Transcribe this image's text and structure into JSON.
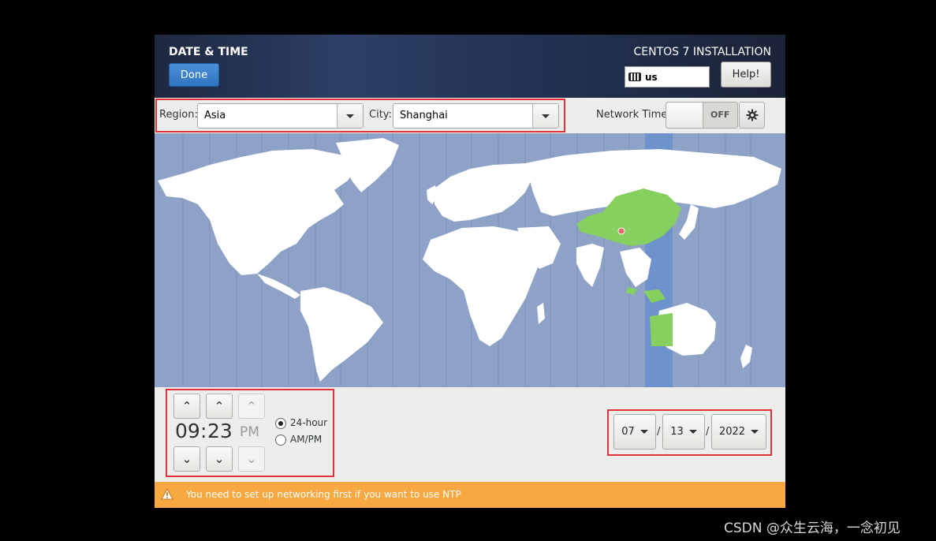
{
  "header": {
    "title": "DATE & TIME",
    "done_label": "Done",
    "install_title": "CENTOS 7 INSTALLATION",
    "keyboard_layout": "us",
    "help_label": "Help!"
  },
  "region_bar": {
    "region_label": "Region:",
    "region_value": "Asia",
    "city_label": "City:",
    "city_value": "Shanghai",
    "network_time_label": "Network Time",
    "network_time_state": "OFF"
  },
  "map": {
    "selected_zone_color": "#6e92cc",
    "selected_country_color": "#85d05f",
    "ocean_color": "#8da2c6",
    "land_color": "#ffffff",
    "pin_color": "#e26a6a"
  },
  "time": {
    "hours": "09",
    "separator": ":",
    "minutes": "23",
    "ampm": "PM",
    "format_24_label": "24-hour",
    "format_ampm_label": "AM/PM",
    "selected_format": "24-hour"
  },
  "date": {
    "month": "07",
    "day": "13",
    "year": "2022",
    "separator": "/"
  },
  "warning": {
    "text": "You need to set up networking first if you want to use NTP"
  },
  "watermark": "CSDN @众生云海，一念初见"
}
